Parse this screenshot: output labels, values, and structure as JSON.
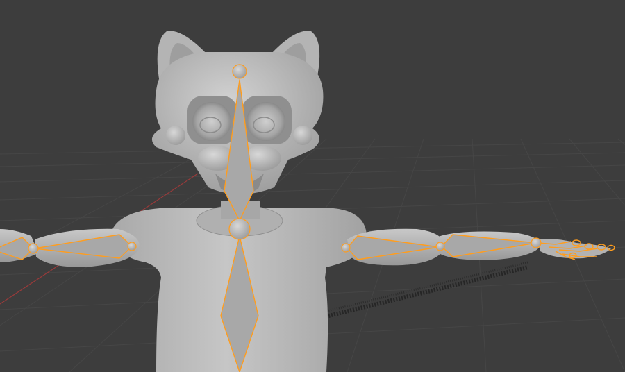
{
  "viewport": {
    "name": "3d-viewport",
    "background": "#3d3d3d",
    "grid_color": "#474747",
    "x_axis_color": "#9a3a3a",
    "model_color": "#bdbdbd",
    "bone_outline_color": "#ff9d1e",
    "bone_fill_color": "#a8a8a8"
  },
  "scene": {
    "model": "character-mesh",
    "armature": "armature"
  }
}
